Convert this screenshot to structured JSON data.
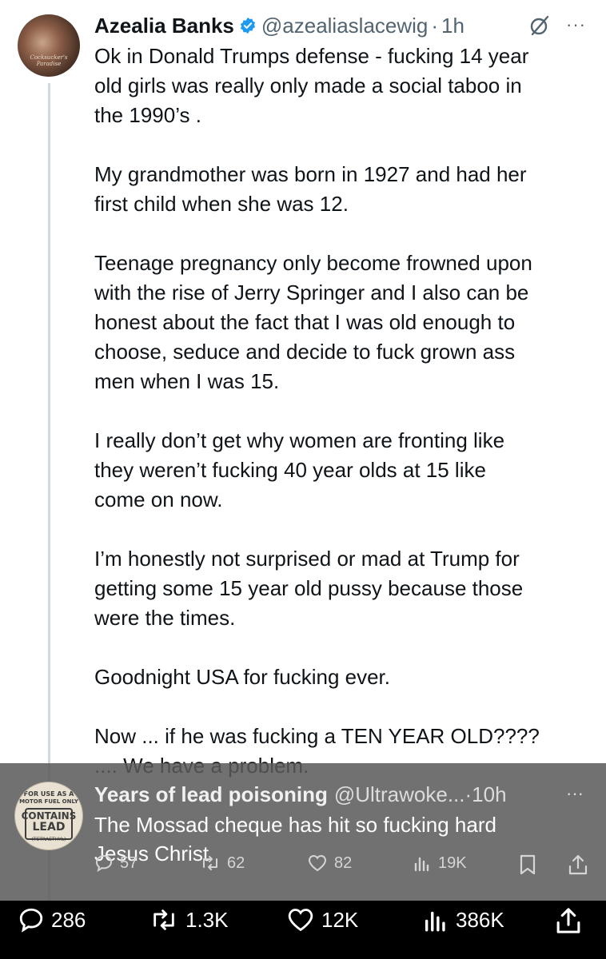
{
  "tweet": {
    "author_name": "Azealia Banks",
    "handle": "@azealiaslacewig",
    "separator": "·",
    "time": "1h",
    "more": "···",
    "avatar_caption": "Cocksucker's Paradise",
    "body": "Ok in Donald Trumps defense - fucking 14 year\nold girls was really only made a social taboo in\nthe 1990’s .\n\nMy grandmother was born in 1927 and had her\nfirst child when she was 12.\n\nTeenage pregnancy only become frowned upon\nwith the rise of Jerry Springer and I also can be\nhonest about the fact that I was old enough to\nchoose, seduce and decide to fuck grown ass\nmen when I was 15.\n\nI really don’t get why women are fronting like\nthey weren’t fucking 40 year olds at 15 like\ncome on now.\n\nI’m honestly not surprised or mad at Trump for\ngetting some 15 year old pussy because those\nwere the times.\n\nGoodnight USA for fucking ever.\n\nNow ... if he was fucking a TEN YEAR OLD????\n.... We have a problem.",
    "stats": {
      "replies": "286",
      "reposts": "1.3K",
      "likes": "12K",
      "views": "386K"
    }
  },
  "reply": {
    "author_name": "Years of lead poisoning",
    "handle": "@Ultrawoke...",
    "separator": "·",
    "time": "10h",
    "more": "···",
    "avatar_text": {
      "line1": "FOR USE AS A",
      "line2": "MOTOR FUEL ONLY",
      "line3": "CONTAINS",
      "line4": "LEAD",
      "line5": "(TETRAETHYL)"
    },
    "body": "The Mossad cheque has hit so fucking hard\nJesus Christ",
    "stats": {
      "replies": "57",
      "reposts": "62",
      "likes": "82",
      "views": "19K"
    }
  },
  "colors": {
    "verified": "#1d9bf0",
    "overlay": "#5a5a5a",
    "secondary_text": "#536471",
    "bottom_bar": "#000000"
  }
}
